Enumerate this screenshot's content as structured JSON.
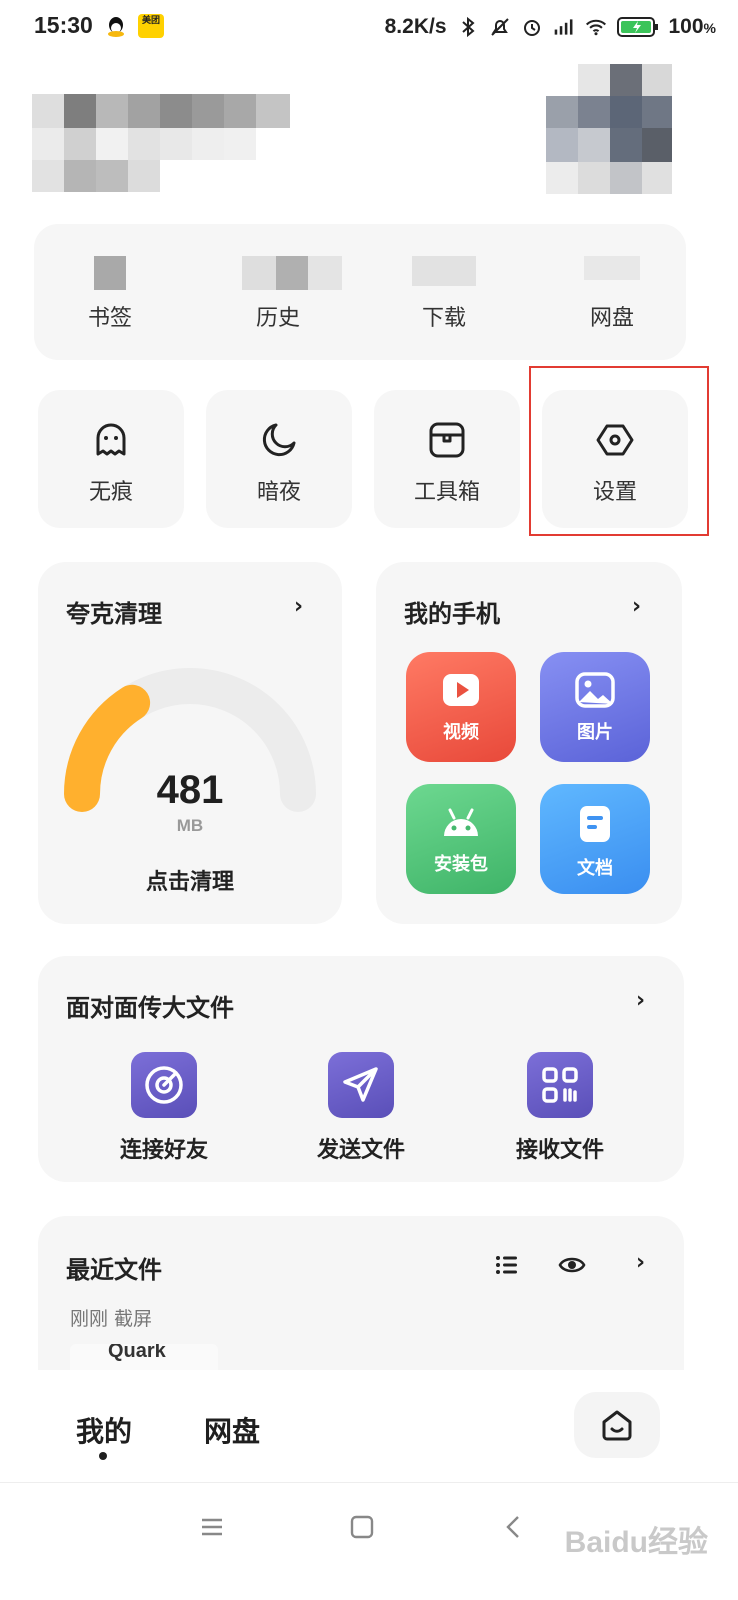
{
  "status_bar": {
    "time": "15:30",
    "network_speed": "8.2K/s",
    "battery_percent": "100",
    "battery_unit": "%",
    "meituan_badge": "美团"
  },
  "quick_bar": [
    {
      "label": "书签"
    },
    {
      "label": "历史"
    },
    {
      "label": "下载"
    },
    {
      "label": "网盘"
    }
  ],
  "tools": [
    {
      "label": "无痕",
      "icon": "ghost-icon"
    },
    {
      "label": "暗夜",
      "icon": "moon-icon"
    },
    {
      "label": "工具箱",
      "icon": "toolbox-icon"
    },
    {
      "label": "设置",
      "icon": "settings-hex-icon"
    }
  ],
  "clean_card": {
    "title": "夸克清理",
    "value": "481",
    "unit": "MB",
    "action": "点击清理",
    "gauge_fill_fraction": 0.32
  },
  "phone_card": {
    "title": "我的手机",
    "apps": [
      {
        "label": "视频",
        "color_from": "#ff6e5a",
        "color_to": "#e84c3d"
      },
      {
        "label": "图片",
        "color_from": "#7d86f0",
        "color_to": "#5b63d8"
      },
      {
        "label": "安装包",
        "color_from": "#6ad58c",
        "color_to": "#41b56a"
      },
      {
        "label": "文档",
        "color_from": "#5ab2ff",
        "color_to": "#3a8ff0"
      }
    ]
  },
  "transfer_card": {
    "title": "面对面传大文件",
    "items": [
      {
        "label": "连接好友"
      },
      {
        "label": "发送文件"
      },
      {
        "label": "接收文件"
      }
    ]
  },
  "recent_card": {
    "title": "最近文件",
    "subtitle": "刚刚 截屏",
    "thumb_text": "Quark"
  },
  "tabs": {
    "mine": "我的",
    "cloud": "网盘"
  },
  "watermark": "Baidu经验",
  "colors": {
    "highlight": "#e23b32",
    "gauge": "#ffb02e",
    "accent_purple": "#6a5ec9"
  }
}
